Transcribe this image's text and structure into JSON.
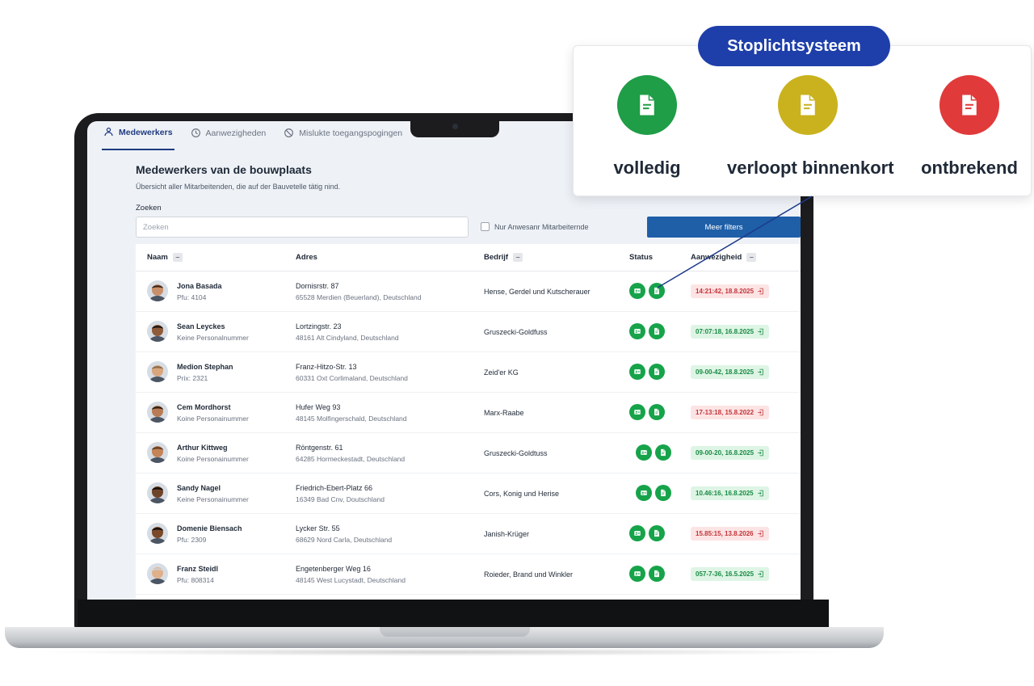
{
  "tabs": [
    {
      "label": "Medewerkers",
      "icon": "users-icon",
      "active": true
    },
    {
      "label": "Aanwezigheden",
      "icon": "clock-icon",
      "active": false
    },
    {
      "label": "Mislukte toegangspogingen",
      "icon": "ban-icon",
      "active": false
    }
  ],
  "page": {
    "title": "Medewerkers van de bouwplaats",
    "subtitle": "Übersicht aller Mitarbeitenden, die auf der Bauvetelle tätig nind."
  },
  "search": {
    "label": "Zoeken",
    "placeholder": "Zoeken",
    "checkbox_label": "Nur Anwesanr Mitarbeiternde",
    "filters_button": "Meer filters"
  },
  "table": {
    "columns": {
      "name": "Naam",
      "address": "Adres",
      "company": "Bedrijf",
      "status": "Status",
      "presence": "Aanwezigheid"
    },
    "rows": [
      {
        "name": "Jona Basada",
        "pnum": "Pfu: 4104",
        "street": "Dornisrstr. 87",
        "city": "65528 Merdien (Beuerland), Deutschland",
        "company": "Hense, Gerdel und Kutscherauer",
        "presence": "14:21:42, 18.8.2025",
        "presence_state": "red"
      },
      {
        "name": "Sean Leyckes",
        "pnum": "Keine Personalnummer",
        "street": "Lortzingstr. 23",
        "city": "48161 Alt Cindyland, Deutschland",
        "company": "Gruszecki-Goldfuss",
        "presence": "07:07:18, 16.8.2025",
        "presence_state": "green"
      },
      {
        "name": "Medion Stephan",
        "pnum": "Prix: 2321",
        "street": "Franz-Hitzo-Str. 13",
        "city": "60331 Oxt Corlimaland, Deutschland",
        "company": "Zeid'er KG",
        "presence": "09-00-42, 18.8.2025",
        "presence_state": "green"
      },
      {
        "name": "Cem Mordhorst",
        "pnum": "Koine Personainummer",
        "street": "Hufer Weg 93",
        "city": "48145 Molfingerschald, Deutschland",
        "company": "Marx-Raabe",
        "presence": "17-13:18, 15.8.2022",
        "presence_state": "red"
      },
      {
        "name": "Arthur Kittweg",
        "pnum": "Koine Personainummer",
        "street": "Röntgenstr. 61",
        "city": "64285 Hormeckestadt, Deutschland",
        "company": "Gruszecki-Goldtuss",
        "presence": "09-00-20, 16.8.2025",
        "presence_state": "green"
      },
      {
        "name": "Sandy Nagel",
        "pnum": "Keine Personainummer",
        "street": "Friedrich-Ebert-Platz 66",
        "city": "16349 Bad Cnv, Doutschland",
        "company": "Cors, Konig und Herise",
        "presence": "10.46:16, 16.8.2025",
        "presence_state": "green"
      },
      {
        "name": "Domenie Biensach",
        "pnum": "Pfu: 2309",
        "street": "Lycker Str. 55",
        "city": "68629 Nord Carla, Deutschland",
        "company": "Janish-Krüger",
        "presence": "15.85:15, 13.8.2026",
        "presence_state": "red"
      },
      {
        "name": "Franz Steidl",
        "pnum": "Pfu: 808314",
        "street": "Engetenberger Weg 16",
        "city": "48145 West Lucystadt, Deutschland",
        "company": "Roieder, Brand und Winkler",
        "presence": "057-7-36, 16.5.2025",
        "presence_state": "green"
      }
    ]
  },
  "legend": {
    "title": "Stoplichtsysteem",
    "items": [
      {
        "label": "volledig",
        "color": "#1f9d47"
      },
      {
        "label": "verloopt binnenkort",
        "color": "#c9b21d"
      },
      {
        "label": "ontbrekend",
        "color": "#e03a3a"
      }
    ]
  },
  "colors": {
    "accent": "#1f3b80",
    "button": "#1e5fa8",
    "status_ok": "#16a34a",
    "presence_in": "#188a43",
    "presence_out": "#c2343a"
  }
}
